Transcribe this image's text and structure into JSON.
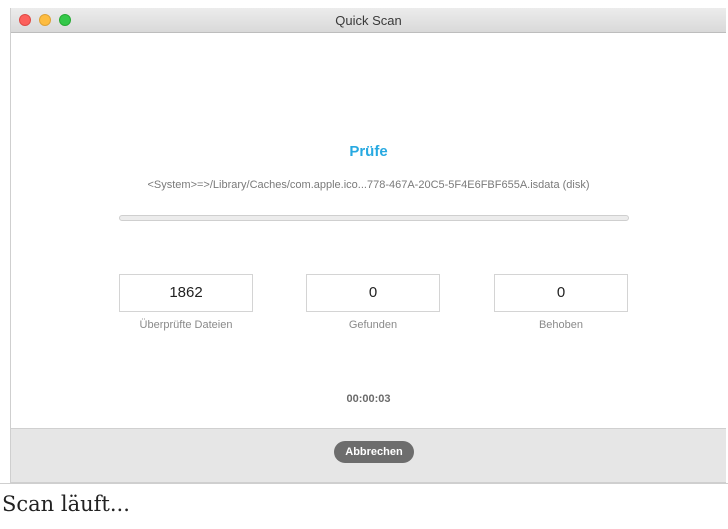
{
  "window": {
    "title": "Quick Scan"
  },
  "scan": {
    "heading": "Prüfe",
    "current_path": "<System>=>/Library/Caches/com.apple.ico...778-467A-20C5-5F4E6FBF655A.isdata (disk)",
    "progress_fraction": 0.0,
    "elapsed": "00:00:03"
  },
  "stats": [
    {
      "value": "1862",
      "label": "Überprüfte Dateien"
    },
    {
      "value": "0",
      "label": "Gefunden"
    },
    {
      "value": "0",
      "label": "Behoben"
    }
  ],
  "footer": {
    "cancel_label": "Abbrechen"
  },
  "caption": "Scan läuft..."
}
